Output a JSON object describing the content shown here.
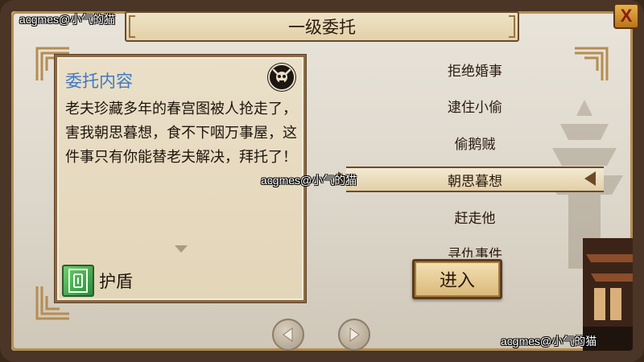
{
  "title": "一级委托",
  "close_label": "X",
  "watermarks": {
    "top_left": "acgmes@小气的猫",
    "center": "acgmes@小气的猫",
    "bottom_right": "acgmes@小气的猫"
  },
  "quest_detail": {
    "heading": "委托内容",
    "description": "老夫珍藏多年的春宫图被人抢走了，害我朝思暮想，食不下咽万事屋，这件事只有你能替老夫解决，拜托了！",
    "reward": {
      "icon": "shield-item-icon",
      "label": "护盾"
    }
  },
  "quest_list": [
    {
      "label": "拒绝婚事",
      "selected": false
    },
    {
      "label": "逮住小偷",
      "selected": false
    },
    {
      "label": "偷鹅贼",
      "selected": false
    },
    {
      "label": "朝思暮想",
      "selected": true
    },
    {
      "label": "赶走他",
      "selected": false
    },
    {
      "label": "寻仇事件",
      "selected": false
    }
  ],
  "enter_label": "进入",
  "nav": {
    "prev_icon": "triangle-left-icon",
    "next_icon": "triangle-right-icon"
  },
  "colors": {
    "heading_blue": "#3f79c4",
    "frame_brown": "#4a3526",
    "parchment": "#e9e4da"
  }
}
